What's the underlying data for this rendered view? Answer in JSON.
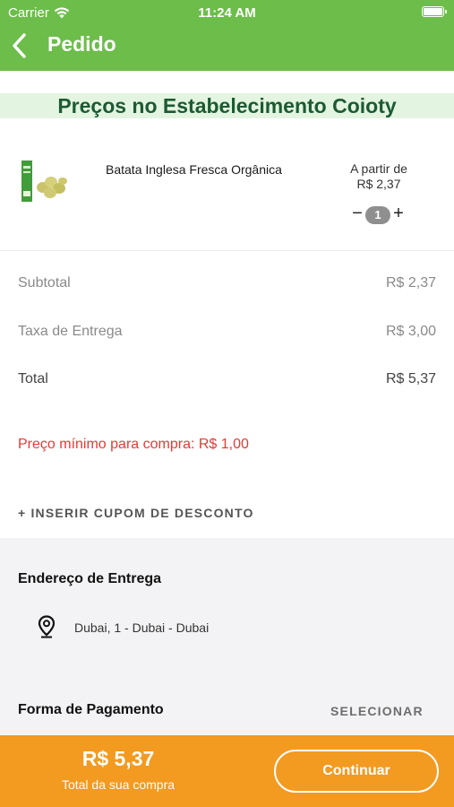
{
  "status_bar": {
    "carrier": "Carrier",
    "time": "11:24 AM"
  },
  "nav": {
    "title": "Pedido"
  },
  "store": {
    "title": "Preços no Estabelecimento Coioty"
  },
  "product": {
    "name": "Batata Inglesa Fresca Orgânica",
    "price_prefix": "A partir de",
    "price": "R$ 2,37",
    "quantity": "1",
    "minus": "−",
    "plus": "+"
  },
  "summary": {
    "subtotal_label": "Subtotal",
    "subtotal_value": "R$ 2,37",
    "delivery_label": "Taxa de Entrega",
    "delivery_value": "R$ 3,00",
    "total_label": "Total",
    "total_value": "R$ 5,37"
  },
  "minimum_notice": "Preço mínimo para compra: R$ 1,00",
  "coupon_label": "+ INSERIR CUPOM DE DESCONTO",
  "delivery": {
    "title": "Endereço de Entrega",
    "address": "Dubai, 1 - Dubai - Dubai",
    "icon": "location-pin-icon"
  },
  "payment": {
    "title": "Forma de Pagamento",
    "select_label": "SELECIONAR"
  },
  "footer": {
    "total": "R$ 5,37",
    "caption": "Total da sua compra",
    "continue_label": "Continuar"
  },
  "colors": {
    "header_green": "#6cbd4a",
    "banner_green": "#e3f5e0",
    "store_title": "#1c5a33",
    "footer_orange": "#f39a20",
    "notice_red": "#e53935"
  }
}
